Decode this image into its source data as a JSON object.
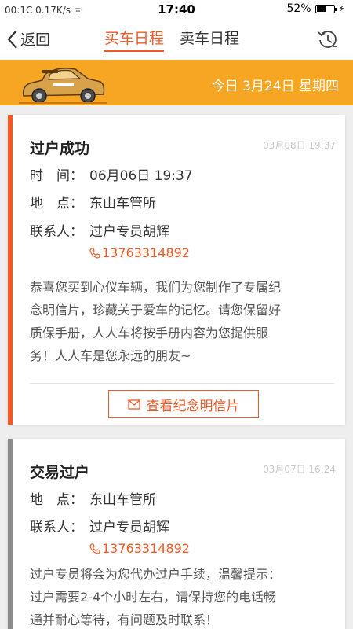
{
  "status_bar": {
    "left_text": "00:1C 0.17K/s ᯤ",
    "time": "17:40",
    "battery": "52%"
  },
  "nav": {
    "back_label": "返回",
    "tabs": [
      {
        "label": "买车日程",
        "active": true
      },
      {
        "label": "卖车日程",
        "active": false
      }
    ]
  },
  "banner": {
    "date_text": "今日 3月24日 星期四",
    "color": "#f6a623"
  },
  "cards": [
    {
      "title": "过户成功",
      "timestamp": "03月08日 19:37",
      "time_label": "时　间：",
      "time_value": "06月06日 19:37",
      "place_label": "地　点：",
      "place_value": "东山车管所",
      "contact_label": "联系人：",
      "contact_value": "过户专员胡辉",
      "phone": "13763314892",
      "desc_lines": [
        "恭喜您买到心仪车辆，我们为您制作了专属纪",
        "念明信片，珍藏关于爱车的记忆。请您保留好",
        "质保手册，人人车将按手册内容为您提供服",
        "务！人人车是您永远的朋友~"
      ],
      "button_label": "查看纪念明信片",
      "accent": "#f05a28"
    },
    {
      "title": "交易过户",
      "timestamp": "03月07日 16:24",
      "place_label": "地　点：",
      "place_value": "东山车管所",
      "contact_label": "联系人：",
      "contact_value": "过户专员胡辉",
      "phone": "13763314892",
      "desc_lines": [
        "过户专员将会为您代办过户手续，温馨提示：",
        "过户需要2-4个小时左右，请保持您的电话畅",
        "通并耐心等待，有问题及时联系！"
      ],
      "accent": "#8c8c8c"
    }
  ]
}
